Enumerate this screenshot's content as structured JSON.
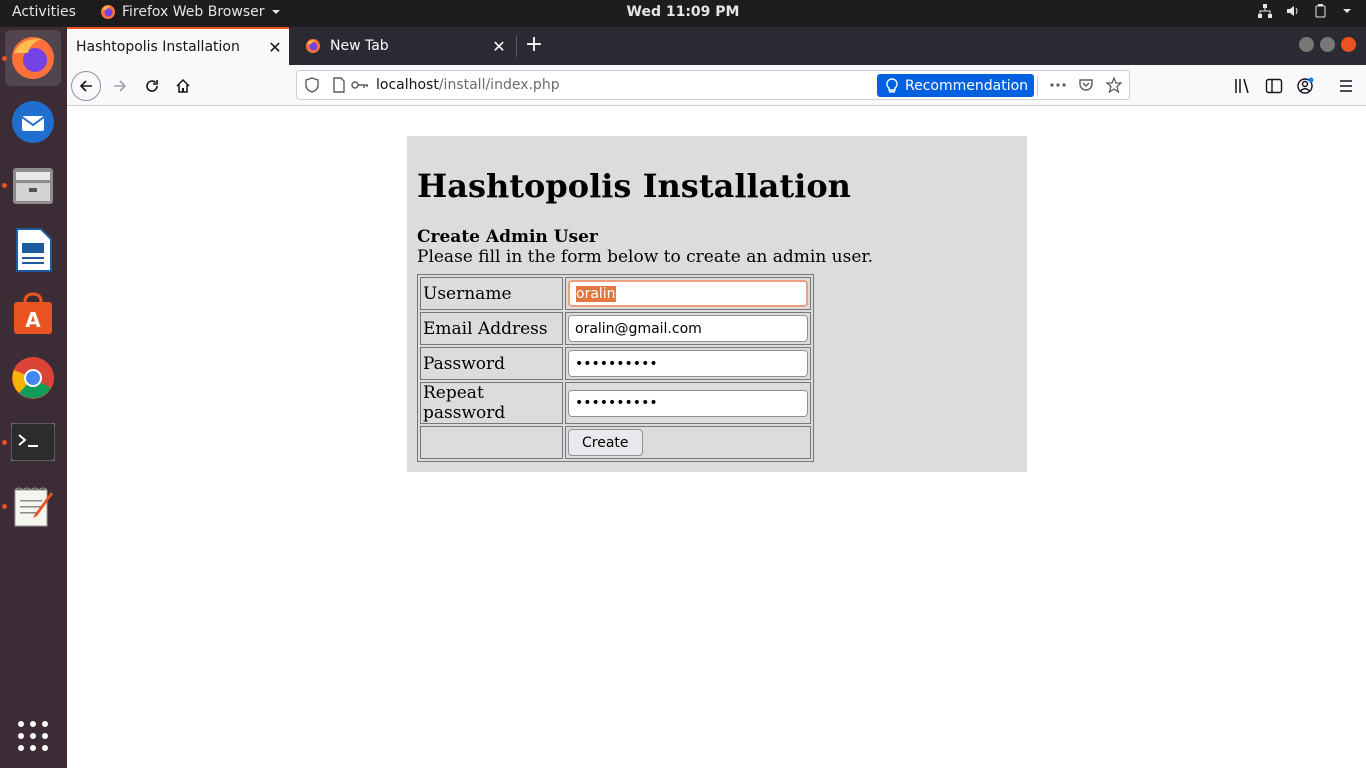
{
  "topbar": {
    "activities": "Activities",
    "app_name": "Firefox Web Browser",
    "clock": "Wed 11:09 PM"
  },
  "browser": {
    "tabs": [
      {
        "title": "Hashtopolis Installation",
        "active": true
      },
      {
        "title": "New Tab",
        "active": false
      }
    ],
    "url": {
      "host": "localhost",
      "path": "/install/index.php"
    },
    "recommendation_label": "Recommendation"
  },
  "page": {
    "title": "Hashtopolis Installation",
    "subtitle": "Create Admin User",
    "description": "Please fill in the form below to create an admin user.",
    "form": {
      "username_label": "Username",
      "username_value": "oralin",
      "email_label": "Email Address",
      "email_value": "oralin@gmail.com",
      "password_label": "Password",
      "password_value": "••••••••••",
      "repeat_label": "Repeat password",
      "repeat_value": "••••••••••",
      "submit_label": "Create"
    }
  },
  "colors": {
    "accent": "#e95420",
    "dock_bg": "#3c2c36",
    "topbar_bg": "#1d1d1d",
    "panel_bg": "#dcdcdc",
    "recommendation_bg": "#0061e0"
  }
}
